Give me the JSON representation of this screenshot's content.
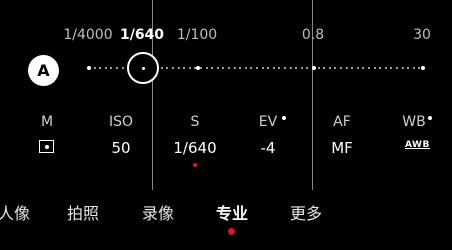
{
  "shutter_scale": {
    "ticks": [
      {
        "label": "1/4000",
        "active": false
      },
      {
        "label": "1/640",
        "active": true
      },
      {
        "label": "1/100",
        "active": false
      },
      {
        "label": "0.8",
        "active": false
      },
      {
        "label": "30",
        "active": false
      }
    ]
  },
  "mode_button": {
    "label": "A"
  },
  "params": {
    "metering": {
      "label": "M",
      "icon": "center-metering-icon"
    },
    "iso": {
      "label": "ISO",
      "value": "50"
    },
    "shutter": {
      "label": "S",
      "value": "1/640"
    },
    "ev": {
      "label": "EV",
      "value": "-4"
    },
    "af": {
      "label": "AF",
      "value": "MF"
    },
    "wb": {
      "label": "WB",
      "value": "AWB"
    }
  },
  "mode_tabs": [
    {
      "label": "人像",
      "active": false
    },
    {
      "label": "拍照",
      "active": false
    },
    {
      "label": "录像",
      "active": false
    },
    {
      "label": "专业",
      "active": true
    },
    {
      "label": "更多",
      "active": false
    }
  ],
  "colors": {
    "accent": "#e0141e",
    "background": "#000000"
  }
}
